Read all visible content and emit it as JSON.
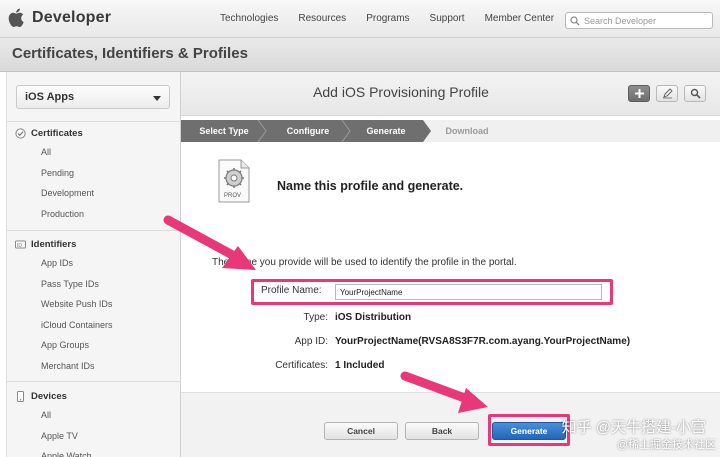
{
  "nav": {
    "brand": "Developer",
    "links": [
      "Technologies",
      "Resources",
      "Programs",
      "Support",
      "Member Center"
    ],
    "search_placeholder": "Search Developer"
  },
  "page_title": "Certificates, Identifiers & Profiles",
  "sidebar": {
    "selector": "iOS Apps",
    "sections": [
      {
        "title": "Certificates",
        "icon": "certificate-icon",
        "items": [
          "All",
          "Pending",
          "Development",
          "Production"
        ]
      },
      {
        "title": "Identifiers",
        "icon": "id-icon",
        "items": [
          "App IDs",
          "Pass Type IDs",
          "Website Push IDs",
          "iCloud Containers",
          "App Groups",
          "Merchant IDs"
        ]
      },
      {
        "title": "Devices",
        "icon": "device-icon",
        "items": [
          "All",
          "Apple TV",
          "Apple Watch"
        ]
      }
    ]
  },
  "main": {
    "title": "Add iOS Provisioning Profile",
    "steps": [
      "Select Type",
      "Configure",
      "Generate",
      "Download"
    ],
    "heading": "Name this profile and generate.",
    "file_icon_label": "PROV",
    "description": "The name you provide will be used to identify the profile in the portal.",
    "profile_name_label": "Profile Name:",
    "profile_name_value": "YourProjectName",
    "type_label": "Type:",
    "type_value": "iOS Distribution",
    "app_id_label": "App ID:",
    "app_id_value": "YourProjectName(RVSA8S3F7R.com.ayang.YourProjectName)",
    "certificates_label": "Certificates:",
    "certificates_value": "1 Included",
    "buttons": {
      "cancel": "Cancel",
      "back": "Back",
      "generate": "Generate"
    }
  },
  "watermark": {
    "line1": "知乎 @天牛搭建-小宫",
    "line2": "@稀土掘金技术社区"
  },
  "colors": {
    "highlight": "#e8387a",
    "step_active": "#6f6f6f",
    "primary_button": "#2466b8"
  }
}
